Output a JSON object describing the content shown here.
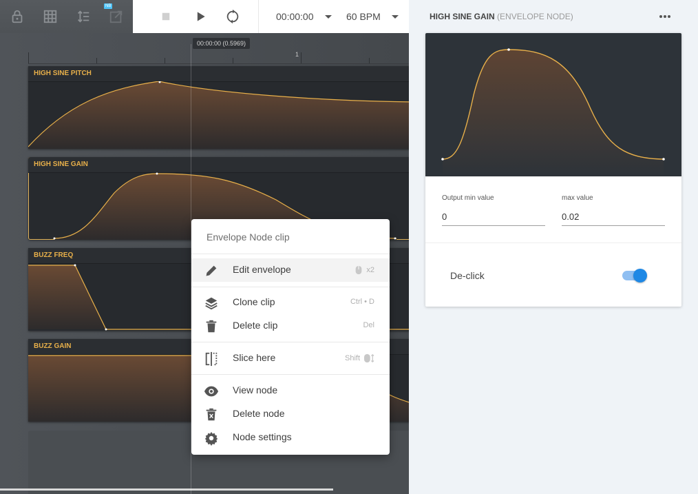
{
  "toolbar": {
    "left_icons": [
      "lock-icon",
      "grid-icon",
      "line-spacing-icon",
      "popout-icon"
    ],
    "popout_badge": "NB"
  },
  "transport": {
    "stop_icon": "stop-icon",
    "play_icon": "play-icon",
    "loop_icon": "loop-icon",
    "time": "00:00:00",
    "tempo": "60 BPM"
  },
  "timeline": {
    "ruler_marker": "1",
    "playhead_label": "00:00:00 (0.5969)",
    "clips": [
      {
        "title": "HIGH SINE PITCH"
      },
      {
        "title": "HIGH SINE GAIN",
        "selected": true
      },
      {
        "title": "BUZZ FREQ"
      },
      {
        "title": "BUZZ GAIN"
      }
    ]
  },
  "context_menu": {
    "title": "Envelope Node clip",
    "items": [
      {
        "label": "Edit envelope",
        "shortcut": "x2",
        "icon": "pencil-icon",
        "shortcut_icon": "mouse-icon"
      },
      {
        "label": "Clone clip",
        "shortcut": "Ctrl • D",
        "icon": "layers-icon"
      },
      {
        "label": "Delete clip",
        "shortcut": "Del",
        "icon": "trash-icon"
      },
      {
        "label": "Slice here",
        "shortcut": "Shift",
        "icon": "slice-icon",
        "shortcut_icon": "mouse-drag-icon"
      },
      {
        "label": "View node",
        "shortcut": "",
        "icon": "eye-icon"
      },
      {
        "label": "Delete node",
        "shortcut": "",
        "icon": "trash-x-icon"
      },
      {
        "label": "Node settings",
        "shortcut": "",
        "icon": "gear-icon"
      }
    ]
  },
  "panel": {
    "title": "HIGH SINE GAIN",
    "subtitle": "(ENVELOPE NODE)",
    "more_icon": "more-horizontal-icon",
    "output_min_label": "Output min value",
    "output_min_value": "0",
    "max_label": "max value",
    "max_value": "0.02",
    "declick_label": "De-click",
    "declick_on": true
  },
  "colors": {
    "accent": "#e8b04a",
    "toggle": "#1e88e5",
    "clip_bg": "#272a2e"
  }
}
